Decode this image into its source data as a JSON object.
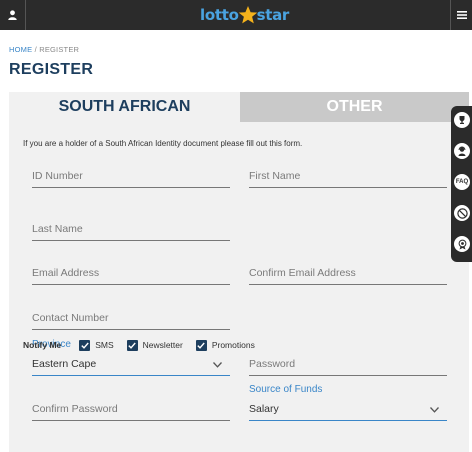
{
  "header": {
    "logo_part1": "lotto",
    "logo_part2": "star",
    "user_icon": "user-icon",
    "menu_icon": "hamburger-menu-icon"
  },
  "breadcrumb": {
    "home": "HOME",
    "separator": "/",
    "current": "REGISTER"
  },
  "page_title": "REGISTER",
  "tabs": [
    {
      "label": "SOUTH AFRICAN",
      "active": true
    },
    {
      "label": "OTHER",
      "active": false
    }
  ],
  "intro_text": "If you are a holder of a South African Identity document please fill out this form.",
  "form": {
    "id_number": {
      "placeholder": "ID Number",
      "value": ""
    },
    "first_name": {
      "placeholder": "First Name",
      "value": ""
    },
    "last_name": {
      "placeholder": "Last Name",
      "value": ""
    },
    "email": {
      "placeholder": "Email Address",
      "value": ""
    },
    "confirm_email": {
      "placeholder": "Confirm Email Address",
      "value": ""
    },
    "contact_number": {
      "placeholder": "Contact Number",
      "value": ""
    },
    "province": {
      "label": "Province",
      "value": "Eastern Cape"
    },
    "password": {
      "placeholder": "Password",
      "value": ""
    },
    "source_of_funds": {
      "label": "Source of Funds",
      "value": "Salary"
    },
    "confirm_password": {
      "placeholder": "Confirm Password",
      "value": ""
    }
  },
  "notify": {
    "label": "Notify Me",
    "options": [
      {
        "label": "SMS",
        "checked": true
      },
      {
        "label": "Newsletter",
        "checked": true
      },
      {
        "label": "Promotions",
        "checked": true
      }
    ]
  },
  "side_rail": [
    {
      "icon": "trophy-icon"
    },
    {
      "icon": "support-agent-icon"
    },
    {
      "icon": "faq-icon",
      "text": "FAQ"
    },
    {
      "icon": "no-entry-18-icon"
    },
    {
      "icon": "responsible-gambling-icon"
    }
  ],
  "colors": {
    "topbar": "#2b2b2b",
    "brand_blue": "#4aa3e0",
    "navy": "#1d3e5e",
    "link_blue": "#3a86c8",
    "star_gold": "#f5b21b"
  }
}
